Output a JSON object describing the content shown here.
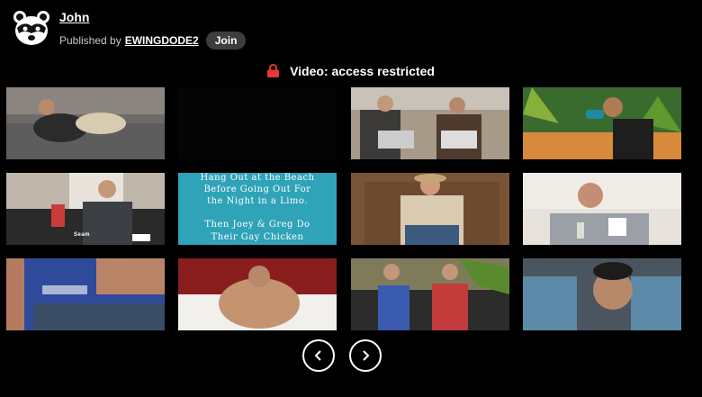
{
  "header": {
    "title": "John",
    "published_by_label": "Published by",
    "author": "EWINGDODE2",
    "join_label": "Join"
  },
  "notice": {
    "text": "Video: access restricted",
    "icon": "lock-icon",
    "icon_color": "#e53935"
  },
  "thumbnails": [
    {
      "id": "t1"
    },
    {
      "id": "t2"
    },
    {
      "id": "t3"
    },
    {
      "id": "t4"
    },
    {
      "id": "t5",
      "caption": "Seam"
    },
    {
      "id": "t6",
      "lines": [
        "Hang Out at the Beach",
        "Before Going Out For",
        "the Night in a Limo.",
        "",
        "Then Joey & Greg Do",
        "Their Gay Chicken"
      ]
    },
    {
      "id": "t7"
    },
    {
      "id": "t8"
    },
    {
      "id": "t9"
    },
    {
      "id": "t10"
    },
    {
      "id": "t11"
    },
    {
      "id": "t12"
    }
  ],
  "pager": {
    "prev_icon": "chevron-left-icon",
    "next_icon": "chevron-right-icon"
  }
}
